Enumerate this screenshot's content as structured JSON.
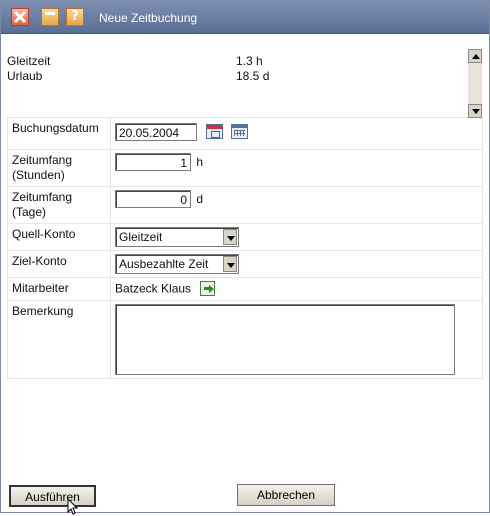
{
  "window": {
    "title": "Neue Zeitbuchung"
  },
  "titlebar_icons": {
    "close": "close-icon",
    "minimize": "minimize-icon",
    "help": "help-icon"
  },
  "summary": {
    "gleitzeit_label": "Gleitzeit",
    "gleitzeit_value": "1.3 h",
    "urlaub_label": "Urlaub",
    "urlaub_value": "18.5 d"
  },
  "form": {
    "buchungsdatum_label": "Buchungsdatum",
    "buchungsdatum_value": "20.05.2004",
    "zeitumfang_stunden_label_1": "Zeitumfang",
    "zeitumfang_stunden_label_2": "(Stunden)",
    "zeitumfang_stunden_value": "1",
    "zeitumfang_stunden_unit": "h",
    "zeitumfang_tage_label_1": "Zeitumfang",
    "zeitumfang_tage_label_2": "(Tage)",
    "zeitumfang_tage_value": "0",
    "zeitumfang_tage_unit": "d",
    "quell_konto_label": "Quell-Konto",
    "quell_konto_value": "Gleitzeit",
    "ziel_konto_label": "Ziel-Konto",
    "ziel_konto_value": "Ausbezahlte Zeit",
    "mitarbeiter_label": "Mitarbeiter",
    "mitarbeiter_value": "Batzeck Klaus",
    "bemerkung_label": "Bemerkung",
    "bemerkung_value": ""
  },
  "buttons": {
    "execute": "Ausführen",
    "cancel": "Abbrechen"
  },
  "colors": {
    "titlebar": "#6b7fa5",
    "title_text": "#ffffff",
    "button_face": "#e6e2d8"
  }
}
